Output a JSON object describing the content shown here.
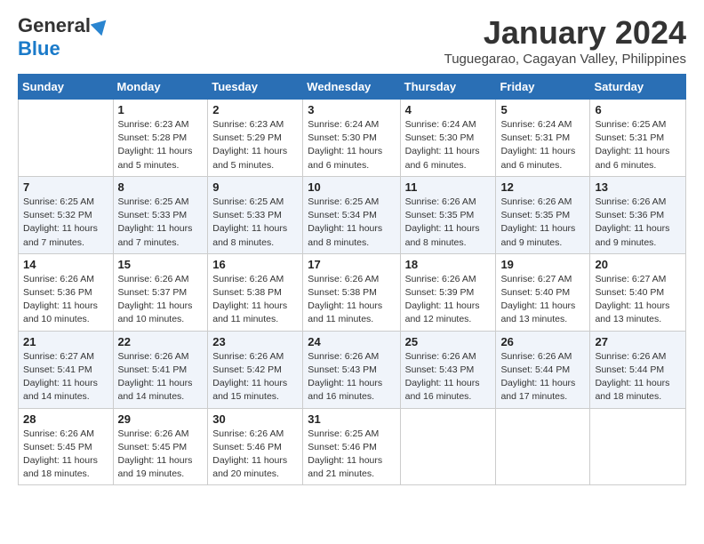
{
  "header": {
    "logo_general": "General",
    "logo_blue": "Blue",
    "month_title": "January 2024",
    "location": "Tuguegarao, Cagayan Valley, Philippines"
  },
  "weekdays": [
    "Sunday",
    "Monday",
    "Tuesday",
    "Wednesday",
    "Thursday",
    "Friday",
    "Saturday"
  ],
  "weeks": [
    [
      {
        "day": "",
        "info": ""
      },
      {
        "day": "1",
        "info": "Sunrise: 6:23 AM\nSunset: 5:28 PM\nDaylight: 11 hours\nand 5 minutes."
      },
      {
        "day": "2",
        "info": "Sunrise: 6:23 AM\nSunset: 5:29 PM\nDaylight: 11 hours\nand 5 minutes."
      },
      {
        "day": "3",
        "info": "Sunrise: 6:24 AM\nSunset: 5:30 PM\nDaylight: 11 hours\nand 6 minutes."
      },
      {
        "day": "4",
        "info": "Sunrise: 6:24 AM\nSunset: 5:30 PM\nDaylight: 11 hours\nand 6 minutes."
      },
      {
        "day": "5",
        "info": "Sunrise: 6:24 AM\nSunset: 5:31 PM\nDaylight: 11 hours\nand 6 minutes."
      },
      {
        "day": "6",
        "info": "Sunrise: 6:25 AM\nSunset: 5:31 PM\nDaylight: 11 hours\nand 6 minutes."
      }
    ],
    [
      {
        "day": "7",
        "info": "Sunrise: 6:25 AM\nSunset: 5:32 PM\nDaylight: 11 hours\nand 7 minutes."
      },
      {
        "day": "8",
        "info": "Sunrise: 6:25 AM\nSunset: 5:33 PM\nDaylight: 11 hours\nand 7 minutes."
      },
      {
        "day": "9",
        "info": "Sunrise: 6:25 AM\nSunset: 5:33 PM\nDaylight: 11 hours\nand 8 minutes."
      },
      {
        "day": "10",
        "info": "Sunrise: 6:25 AM\nSunset: 5:34 PM\nDaylight: 11 hours\nand 8 minutes."
      },
      {
        "day": "11",
        "info": "Sunrise: 6:26 AM\nSunset: 5:35 PM\nDaylight: 11 hours\nand 8 minutes."
      },
      {
        "day": "12",
        "info": "Sunrise: 6:26 AM\nSunset: 5:35 PM\nDaylight: 11 hours\nand 9 minutes."
      },
      {
        "day": "13",
        "info": "Sunrise: 6:26 AM\nSunset: 5:36 PM\nDaylight: 11 hours\nand 9 minutes."
      }
    ],
    [
      {
        "day": "14",
        "info": "Sunrise: 6:26 AM\nSunset: 5:36 PM\nDaylight: 11 hours\nand 10 minutes."
      },
      {
        "day": "15",
        "info": "Sunrise: 6:26 AM\nSunset: 5:37 PM\nDaylight: 11 hours\nand 10 minutes."
      },
      {
        "day": "16",
        "info": "Sunrise: 6:26 AM\nSunset: 5:38 PM\nDaylight: 11 hours\nand 11 minutes."
      },
      {
        "day": "17",
        "info": "Sunrise: 6:26 AM\nSunset: 5:38 PM\nDaylight: 11 hours\nand 11 minutes."
      },
      {
        "day": "18",
        "info": "Sunrise: 6:26 AM\nSunset: 5:39 PM\nDaylight: 11 hours\nand 12 minutes."
      },
      {
        "day": "19",
        "info": "Sunrise: 6:27 AM\nSunset: 5:40 PM\nDaylight: 11 hours\nand 13 minutes."
      },
      {
        "day": "20",
        "info": "Sunrise: 6:27 AM\nSunset: 5:40 PM\nDaylight: 11 hours\nand 13 minutes."
      }
    ],
    [
      {
        "day": "21",
        "info": "Sunrise: 6:27 AM\nSunset: 5:41 PM\nDaylight: 11 hours\nand 14 minutes."
      },
      {
        "day": "22",
        "info": "Sunrise: 6:26 AM\nSunset: 5:41 PM\nDaylight: 11 hours\nand 14 minutes."
      },
      {
        "day": "23",
        "info": "Sunrise: 6:26 AM\nSunset: 5:42 PM\nDaylight: 11 hours\nand 15 minutes."
      },
      {
        "day": "24",
        "info": "Sunrise: 6:26 AM\nSunset: 5:43 PM\nDaylight: 11 hours\nand 16 minutes."
      },
      {
        "day": "25",
        "info": "Sunrise: 6:26 AM\nSunset: 5:43 PM\nDaylight: 11 hours\nand 16 minutes."
      },
      {
        "day": "26",
        "info": "Sunrise: 6:26 AM\nSunset: 5:44 PM\nDaylight: 11 hours\nand 17 minutes."
      },
      {
        "day": "27",
        "info": "Sunrise: 6:26 AM\nSunset: 5:44 PM\nDaylight: 11 hours\nand 18 minutes."
      }
    ],
    [
      {
        "day": "28",
        "info": "Sunrise: 6:26 AM\nSunset: 5:45 PM\nDaylight: 11 hours\nand 18 minutes."
      },
      {
        "day": "29",
        "info": "Sunrise: 6:26 AM\nSunset: 5:45 PM\nDaylight: 11 hours\nand 19 minutes."
      },
      {
        "day": "30",
        "info": "Sunrise: 6:26 AM\nSunset: 5:46 PM\nDaylight: 11 hours\nand 20 minutes."
      },
      {
        "day": "31",
        "info": "Sunrise: 6:25 AM\nSunset: 5:46 PM\nDaylight: 11 hours\nand 21 minutes."
      },
      {
        "day": "",
        "info": ""
      },
      {
        "day": "",
        "info": ""
      },
      {
        "day": "",
        "info": ""
      }
    ]
  ]
}
